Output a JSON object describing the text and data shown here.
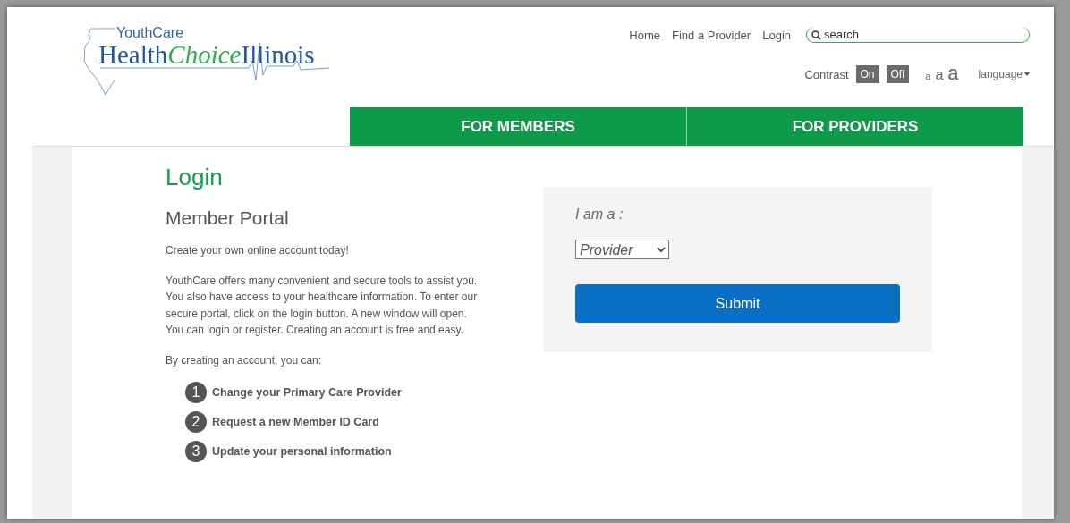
{
  "logo": {
    "tagline": "YouthCare",
    "name_start": "Health",
    "name_mid": "Choice",
    "name_end": "Illinois"
  },
  "top_links": [
    "Home",
    "Find a Provider",
    "Login"
  ],
  "search": {
    "placeholder": "search"
  },
  "contrast": {
    "label": "Contrast",
    "buttons": [
      "On",
      "Off"
    ]
  },
  "text_sizes": [
    "a",
    "a",
    "a"
  ],
  "language": "language",
  "main_nav": [
    "FOR MEMBERS",
    "FOR PROVIDERS"
  ],
  "page_title": "Login",
  "section_title": "Member Portal",
  "paragraphs": [
    "Create your own online account today!",
    "YouthCare offers many convenient and secure tools to assist you. You also have access to your healthcare information. To enter our secure portal, click on the login button. A new window will open. You can login or register. Creating an account is free and easy.",
    "By creating an account, you can:"
  ],
  "benefits": [
    {
      "number": "1",
      "text": "Change your Primary Care Provider"
    },
    {
      "number": "2",
      "text": "Request a new Member ID Card"
    },
    {
      "number": "3",
      "text": "Update your personal information"
    }
  ],
  "login_form": {
    "label": "I am a :",
    "role": "Provider",
    "submit": "Submit"
  }
}
